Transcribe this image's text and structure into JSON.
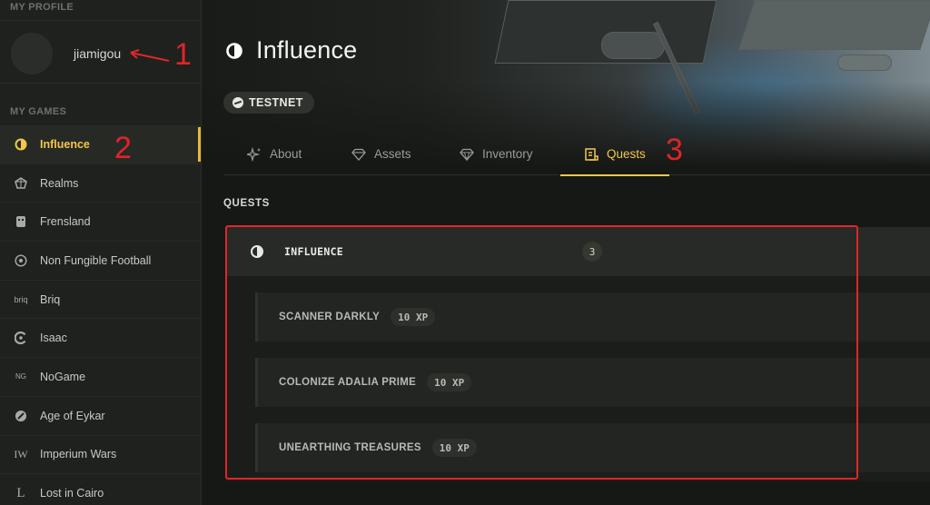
{
  "sidebar": {
    "profile_label": "MY PROFILE",
    "username": "jiamigou",
    "games_label": "MY GAMES",
    "games": [
      {
        "label": "Influence",
        "icon": "influence-logo-icon",
        "active": true
      },
      {
        "label": "Realms",
        "icon": "realms-icon"
      },
      {
        "label": "Frensland",
        "icon": "frensland-icon"
      },
      {
        "label": "Non Fungible Football",
        "icon": "football-icon"
      },
      {
        "label": "Briq",
        "icon": "briq-icon",
        "glyph": "briq"
      },
      {
        "label": "Isaac",
        "icon": "isaac-icon"
      },
      {
        "label": "NoGame",
        "icon": "nogame-icon",
        "glyph": "NG"
      },
      {
        "label": "Age of Eykar",
        "icon": "eykar-icon"
      },
      {
        "label": "Imperium Wars",
        "icon": "imperium-icon",
        "glyph": "IW"
      },
      {
        "label": "Lost in Cairo",
        "icon": "cairo-icon",
        "glyph": "L"
      }
    ]
  },
  "header": {
    "title": "Influence",
    "network_badge": "TESTNET"
  },
  "tabs": [
    {
      "label": "About",
      "icon": "sparkle-icon"
    },
    {
      "label": "Assets",
      "icon": "diamond-icon"
    },
    {
      "label": "Inventory",
      "icon": "gem-icon"
    },
    {
      "label": "Quests",
      "icon": "quest-icon",
      "active": true
    }
  ],
  "quests": {
    "section_title": "QUESTS",
    "group": {
      "name": "INFLUENCE",
      "count": "3"
    },
    "items": [
      {
        "name": "SCANNER DARKLY",
        "xp": "10 XP"
      },
      {
        "name": "COLONIZE ADALIA PRIME",
        "xp": "10 XP"
      },
      {
        "name": "UNEARTHING TREASURES",
        "xp": "10 XP"
      }
    ]
  },
  "annotations": {
    "one": "1",
    "two": "2",
    "three": "3"
  },
  "colors": {
    "accent": "#f3c64f",
    "annotation": "#e0262a",
    "background": "#161815"
  }
}
